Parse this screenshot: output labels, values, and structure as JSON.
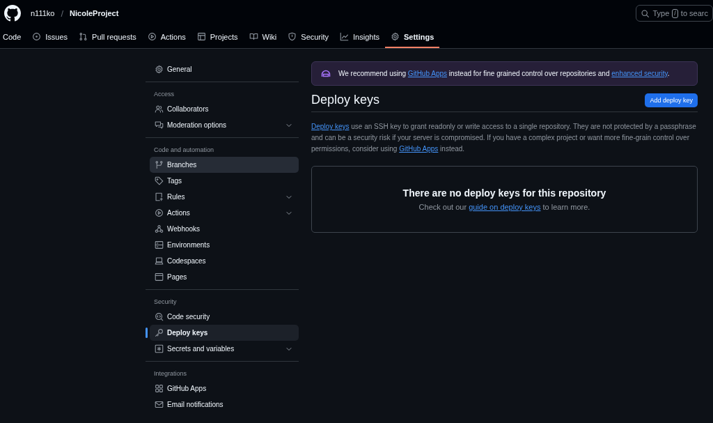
{
  "header": {
    "owner": "n111ko",
    "separator": "/",
    "repo": "NicoleProject",
    "search": {
      "placeholder_parts": [
        "Type",
        "/",
        "to searc"
      ]
    }
  },
  "tabs": [
    {
      "label": "Code",
      "selected": false
    },
    {
      "label": "Issues",
      "selected": false
    },
    {
      "label": "Pull requests",
      "selected": false
    },
    {
      "label": "Actions",
      "selected": false
    },
    {
      "label": "Projects",
      "selected": false
    },
    {
      "label": "Wiki",
      "selected": false
    },
    {
      "label": "Security",
      "selected": false
    },
    {
      "label": "Insights",
      "selected": false
    },
    {
      "label": "Settings",
      "selected": true
    }
  ],
  "sidebar": {
    "groups": [
      {
        "items": [
          {
            "label": "General",
            "selected": false,
            "hovered": false,
            "expandable": false
          }
        ]
      },
      {
        "heading": "Access",
        "items": [
          {
            "label": "Collaborators",
            "selected": false,
            "hovered": false,
            "expandable": false
          },
          {
            "label": "Moderation options",
            "selected": false,
            "hovered": false,
            "expandable": true
          }
        ]
      },
      {
        "heading": "Code and automation",
        "items": [
          {
            "label": "Branches",
            "selected": false,
            "hovered": true,
            "expandable": false
          },
          {
            "label": "Tags",
            "selected": false,
            "hovered": false,
            "expandable": false
          },
          {
            "label": "Rules",
            "selected": false,
            "hovered": false,
            "expandable": true
          },
          {
            "label": "Actions",
            "selected": false,
            "hovered": false,
            "expandable": true
          },
          {
            "label": "Webhooks",
            "selected": false,
            "hovered": false,
            "expandable": false
          },
          {
            "label": "Environments",
            "selected": false,
            "hovered": false,
            "expandable": false
          },
          {
            "label": "Codespaces",
            "selected": false,
            "hovered": false,
            "expandable": false
          },
          {
            "label": "Pages",
            "selected": false,
            "hovered": false,
            "expandable": false
          }
        ]
      },
      {
        "heading": "Security",
        "items": [
          {
            "label": "Code security",
            "selected": false,
            "hovered": false,
            "expandable": false
          },
          {
            "label": "Deploy keys",
            "selected": true,
            "hovered": false,
            "expandable": false
          },
          {
            "label": "Secrets and variables",
            "selected": false,
            "hovered": false,
            "expandable": true
          }
        ]
      },
      {
        "heading": "Integrations",
        "items": [
          {
            "label": "GitHub Apps",
            "selected": false,
            "hovered": false,
            "expandable": false
          },
          {
            "label": "Email notifications",
            "selected": false,
            "hovered": false,
            "expandable": false
          }
        ]
      }
    ]
  },
  "banner": {
    "text": [
      {
        "kind": "text",
        "text": "We recommend using "
      },
      {
        "kind": "link",
        "text": "GitHub Apps"
      },
      {
        "kind": "text",
        "text": " instead for fine grained control over repositories and "
      },
      {
        "kind": "link",
        "text": "enhanced security"
      },
      {
        "kind": "text",
        "text": "."
      }
    ]
  },
  "page": {
    "title": "Deploy keys",
    "button": "Add deploy key",
    "description": [
      {
        "kind": "link",
        "text": "Deploy keys"
      },
      {
        "kind": "text",
        "text": " use an SSH key to grant readonly or write access to a single repository. They are not protected by a passphrase and can be a security risk if your server is compromised. If you have a complex project or want more fine-grain control over permissions, consider using "
      },
      {
        "kind": "link",
        "text": "GitHub Apps"
      },
      {
        "kind": "text",
        "text": " instead."
      }
    ]
  },
  "empty_state": {
    "title": "There are no deploy keys for this repository",
    "text": [
      {
        "kind": "text",
        "text": "Check out our "
      },
      {
        "kind": "link",
        "text": "guide on deploy keys"
      },
      {
        "kind": "text",
        "text": " to learn more."
      }
    ]
  }
}
